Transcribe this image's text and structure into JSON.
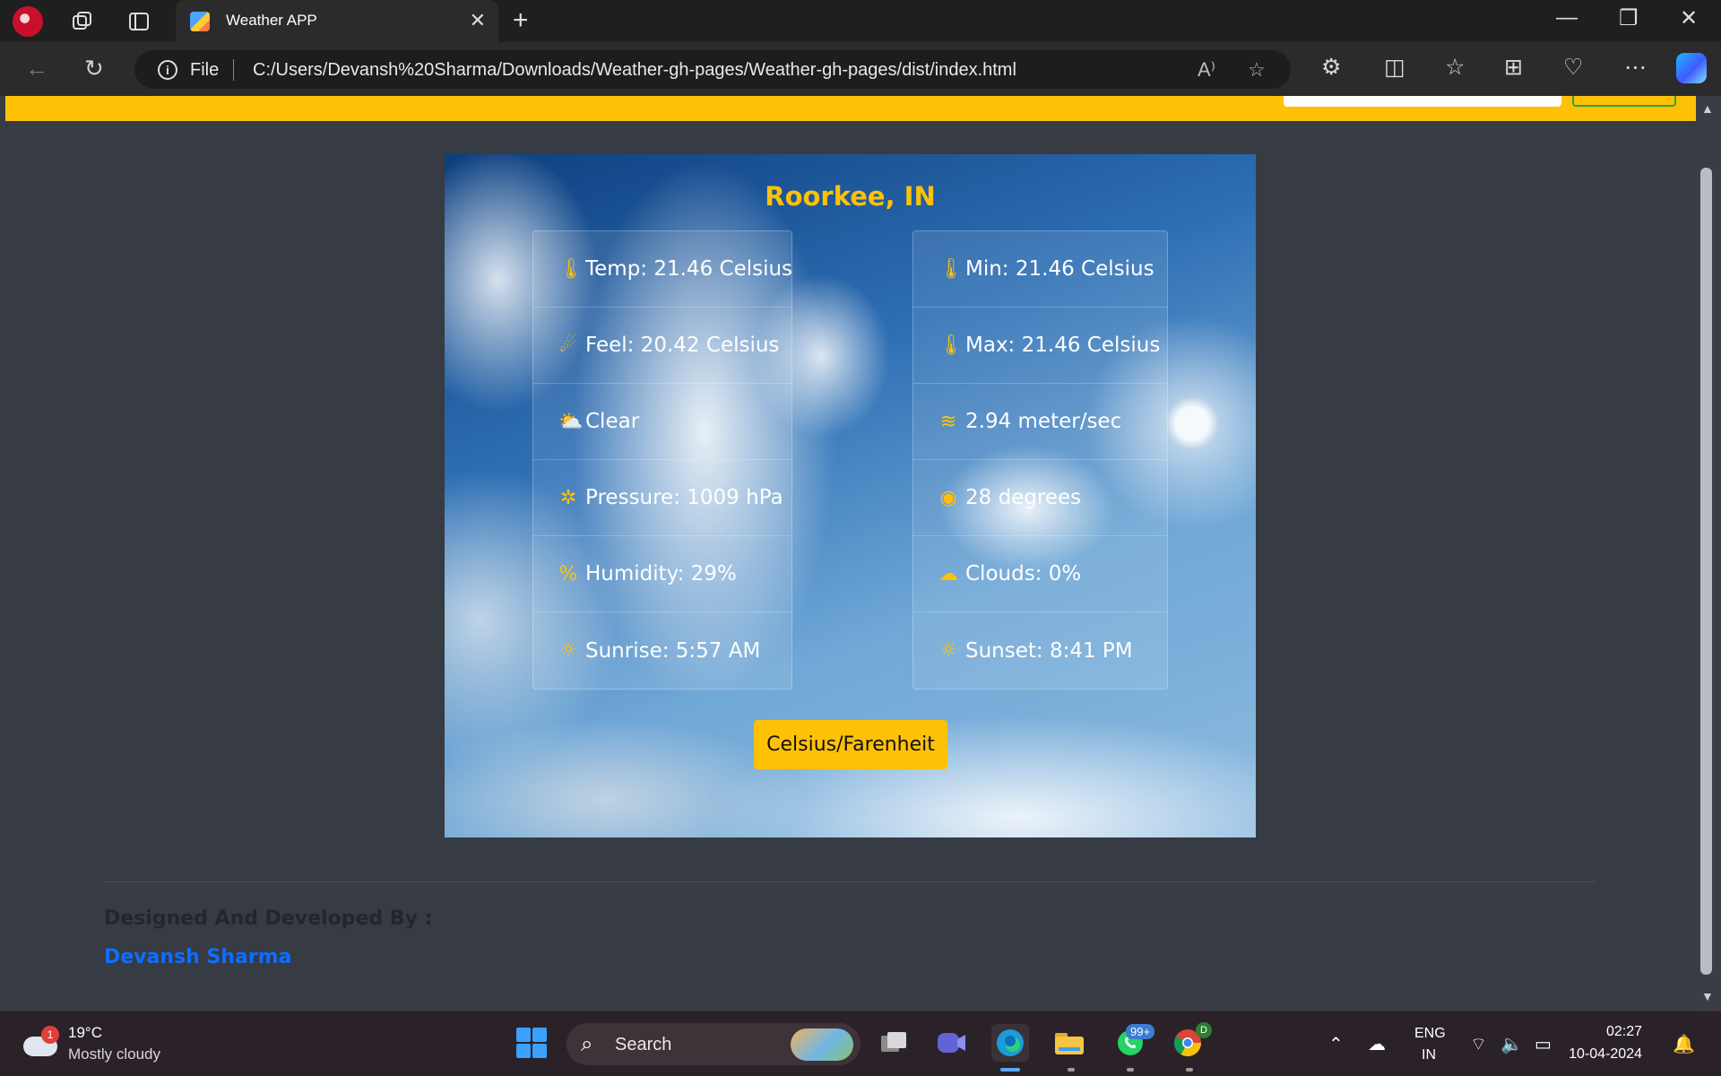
{
  "browser": {
    "tab_title": "Weather APP",
    "file_label": "File",
    "url": "C:/Users/Devansh%20Sharma/Downloads/Weather-gh-pages/Weather-gh-pages/dist/index.html"
  },
  "weather": {
    "city": "Roorkee, IN",
    "left": [
      {
        "icon": "thermometer-icon",
        "text": "Temp: 21.46 Celsius"
      },
      {
        "icon": "feel-icon",
        "text": "Feel: 20.42 Celsius"
      },
      {
        "icon": "sun-cloud-icon",
        "text": "Clear"
      },
      {
        "icon": "pressure-icon",
        "text": "Pressure: 1009 hPa"
      },
      {
        "icon": "percent-icon",
        "text": "Humidity: 29%"
      },
      {
        "icon": "sunrise-icon",
        "text": "Sunrise: 5:57 AM"
      }
    ],
    "right": [
      {
        "icon": "temperature-min-icon",
        "text": "Min: 21.46 Celsius"
      },
      {
        "icon": "temperature-max-icon",
        "text": "Max: 21.46 Celsius"
      },
      {
        "icon": "wind-icon",
        "text": "2.94 meter/sec"
      },
      {
        "icon": "compass-icon",
        "text": "28 degrees"
      },
      {
        "icon": "cloud-icon",
        "text": "Clouds: 0%"
      },
      {
        "icon": "sunset-icon",
        "text": "Sunset: 8:41 PM"
      }
    ],
    "unit_button": "Celsius/Farenheit"
  },
  "footer": {
    "designed_by": "Designed And Developed By :",
    "author": "Devansh Sharma"
  },
  "taskbar": {
    "weather_badge": "1",
    "temperature": "19°C",
    "condition": "Mostly cloudy",
    "search_label": "Search",
    "whatsapp_badge": "99+",
    "chrome_badge": "D",
    "language": "ENG",
    "region": "IN",
    "time": "02:27",
    "date": "10-04-2024"
  },
  "colors": {
    "accent": "#ffc107",
    "page_bg": "#373b44",
    "link": "#0d6efd"
  }
}
